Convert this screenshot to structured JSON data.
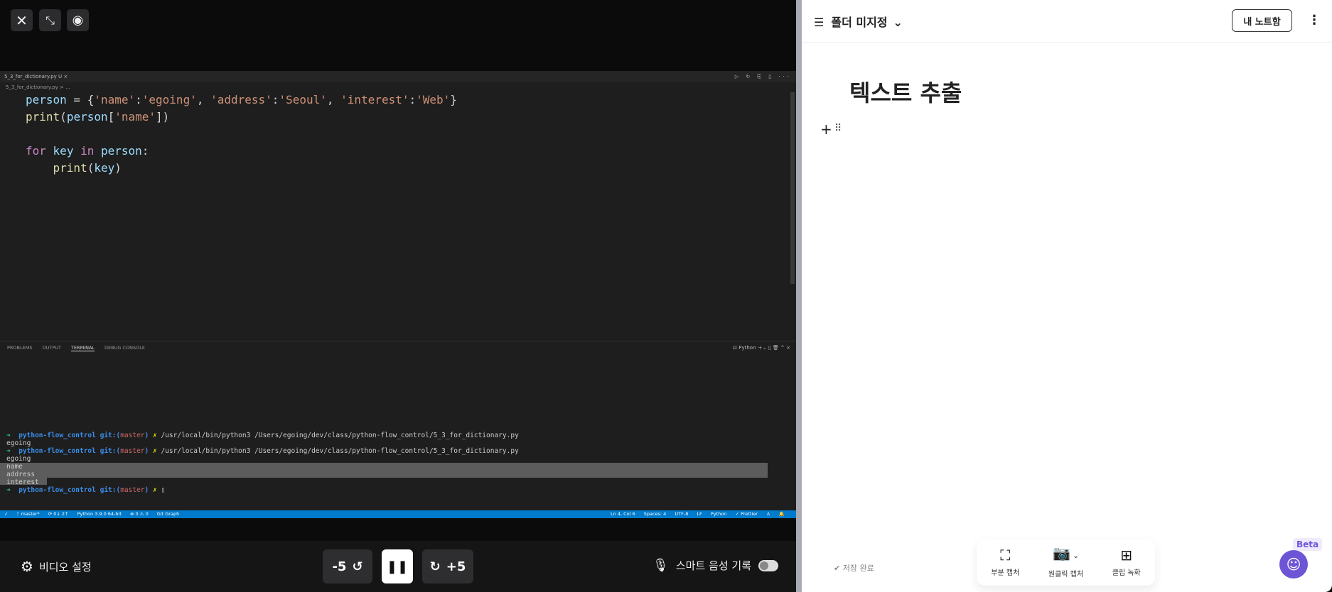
{
  "player": {
    "video_settings": "비디오 설정",
    "back": "-5",
    "forward": "+5",
    "smart_voice": "스마트 음성 기록"
  },
  "editor": {
    "tab": "5_3_for_dictionary.py U ×",
    "tab_actions": "▷ ↻ ⎘ ▯ ···",
    "breadcrumb": "5_3_for_dictionary.py > ...",
    "panel_tabs": [
      "PROBLEMS",
      "OUTPUT",
      "TERMINAL",
      "DEBUG CONSOLE"
    ],
    "panel_actions": "⊡ Python ＋⌄ ▯ 🗑 ^ ×",
    "terminal": {
      "arrow": "➜",
      "dir": "python-flow_control",
      "git": "git:(",
      "branch": "master",
      "close": ")",
      "x": "✗",
      "cmd": "/usr/local/bin/python3 /Users/egoing/dev/class/python-flow_control/5_3_for_dictionary.py",
      "out1": "egoing",
      "out2": "egoing",
      "out3": "name",
      "out4": "address",
      "out5": "interest",
      "cursor": "▯"
    },
    "status_left": [
      "✓",
      "ᚠ master*",
      "⟳ 0↓ 2↑",
      "Python 3.9.0 64-bit",
      "⊗ 0 ⚠ 0",
      "Git Graph"
    ],
    "status_right": [
      "Ln 4, Col 6",
      "Spaces: 4",
      "UTF-8",
      "LF",
      "Python",
      "✓ Prettier",
      "♙",
      "🔔"
    ]
  },
  "note": {
    "folder": "폴더 미지정",
    "my_notes": "내 노트함",
    "title": "텍스트 추출",
    "saved": "✔ 저장 완료",
    "tools": [
      {
        "icon": "⛶",
        "label": "부분 캡처"
      },
      {
        "icon": "📷",
        "label": "원클릭 캡처"
      },
      {
        "icon": "⊞",
        "label": "클립 녹화"
      }
    ],
    "beta": "Beta"
  }
}
